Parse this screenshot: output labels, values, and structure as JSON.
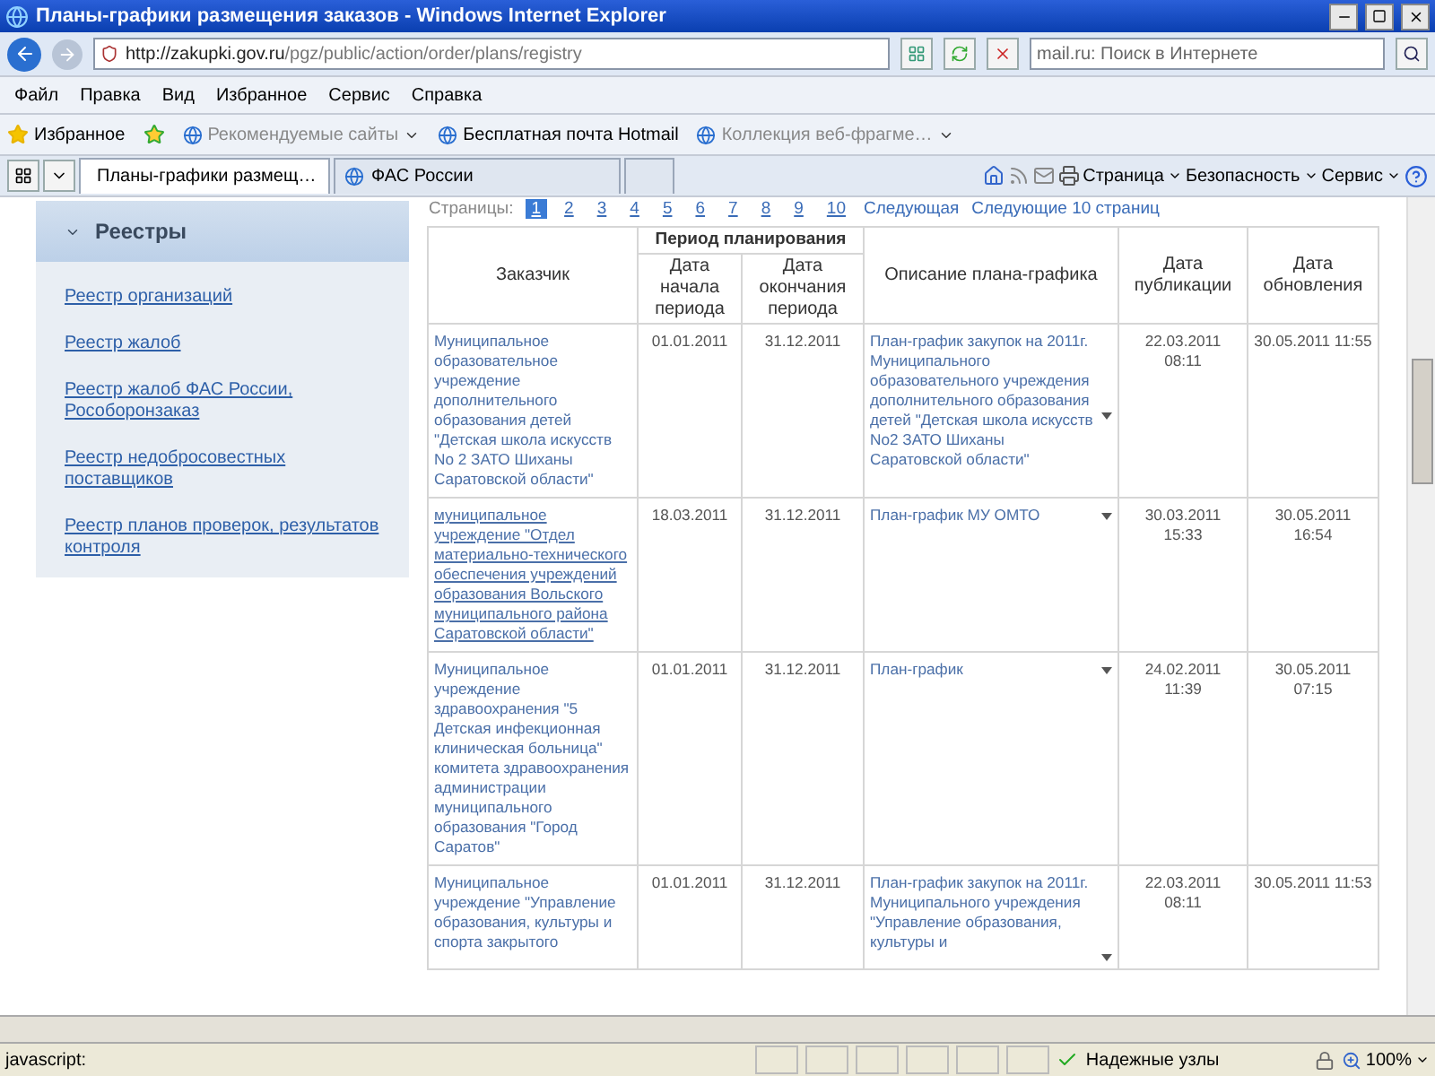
{
  "window": {
    "title": "Планы-графики размещения заказов - Windows Internet Explorer"
  },
  "address_bar": {
    "url_host": "http://zakupki.gov.ru",
    "url_path": "/pgz/public/action/order/plans/registry"
  },
  "search": {
    "placeholder": "mail.ru: Поиск в Интернете"
  },
  "menu": [
    "Файл",
    "Правка",
    "Вид",
    "Избранное",
    "Сервис",
    "Справка"
  ],
  "favorites_bar": {
    "label": "Избранное",
    "items": [
      {
        "label": "Рекомендуемые сайты",
        "disabled": true,
        "dropdown": true
      },
      {
        "label": "Бесплатная почта Hotmail",
        "disabled": false,
        "dropdown": false
      },
      {
        "label": "Коллекция веб-фрагме…",
        "disabled": true,
        "dropdown": true
      }
    ]
  },
  "tabs": [
    {
      "label": "Планы-графики размещ…",
      "selected": true
    },
    {
      "label": "ФАС России",
      "selected": false
    }
  ],
  "command_bar": [
    "Страница",
    "Безопасность",
    "Сервис"
  ],
  "sidebar": {
    "title": "Реестры",
    "expanded": true,
    "links": [
      "Реестр организаций",
      "Реестр жалоб",
      "Реестр жалоб ФАС России, Рособоронзаказ",
      "Реестр недобросовестных поставщиков",
      "Реестр планов проверок, результатов контроля"
    ]
  },
  "pager": {
    "label": "Страницы:",
    "pages": [
      {
        "label": "1",
        "selected": true
      },
      {
        "label": "2",
        "selected": false
      },
      {
        "label": "3",
        "selected": false
      },
      {
        "label": "4",
        "selected": false
      },
      {
        "label": "5",
        "selected": false
      },
      {
        "label": "6",
        "selected": false
      },
      {
        "label": "7",
        "selected": false
      },
      {
        "label": "8",
        "selected": false
      },
      {
        "label": "9",
        "selected": false
      },
      {
        "label": "10",
        "selected": false
      }
    ],
    "next": "Следующая",
    "next_ten": "Следующие 10 страниц"
  },
  "table": {
    "group_header": "Период планирования",
    "columns": [
      "Заказчик",
      "Дата начала периода",
      "Дата окончания периода",
      "Описание плана-графика",
      "Дата публикации",
      "Дата обновления"
    ],
    "rows": [
      {
        "customer": "Муниципальное образовательное учреждение дополнительного образования детей \"Детская школа искусств No 2 ЗАТО Шиханы Саратовской области\"",
        "underlined": false,
        "start": "01.01.2011",
        "end": "31.12.2011",
        "description": "План-график закупок на 2011г. Муниципального образовательного учреждения дополнительного образования детей \"Детская школа искусств No2 ЗАТО Шиханы Саратовской области\"",
        "published": "22.03.2011 08:11",
        "updated": "30.05.2011 11:55"
      },
      {
        "customer": "муниципальное учреждение \"Отдел материально-технического обеспечения учреждений образования Вольского муниципального района Саратовской области\"",
        "underlined": true,
        "start": "18.03.2011",
        "end": "31.12.2011",
        "description": "План-график МУ ОМТО",
        "published": "30.03.2011 15:33",
        "updated": "30.05.2011 16:54"
      },
      {
        "customer": "Муниципальное учреждение здравоохранения \"5 Детская инфекционная клиническая больница\" комитета здравоохранения администрации муниципального образования \"Город Саратов\"",
        "underlined": false,
        "start": "01.01.2011",
        "end": "31.12.2011",
        "description": "План-график",
        "published": "24.02.2011 11:39",
        "updated": "30.05.2011 07:15"
      },
      {
        "customer": "Муниципальное учреждение \"Управление образования, культуры и спорта закрытого",
        "underlined": false,
        "start": "01.01.2011",
        "end": "31.12.2011",
        "description": "План-график закупок на 2011г. Муниципального учреждения \"Управление образования, культуры и",
        "published": "22.03.2011 08:11",
        "updated": "30.05.2011 11:53"
      }
    ]
  },
  "status_bar": {
    "text": "javascript:",
    "zone": "Надежные узлы",
    "zoom": "100%"
  }
}
